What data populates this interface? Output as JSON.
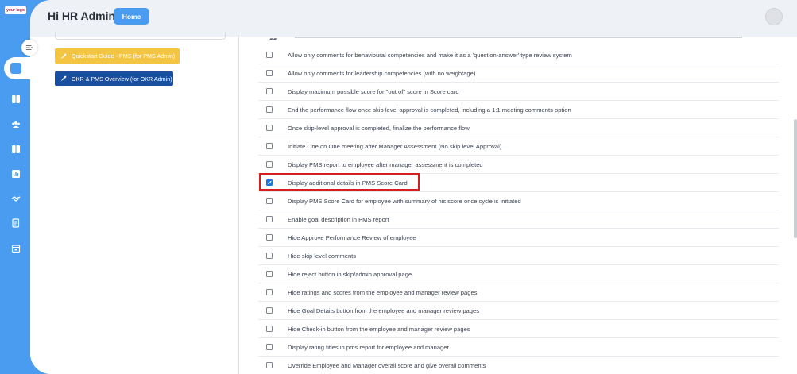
{
  "brand": {
    "logo_text": "your logo"
  },
  "header": {
    "greeting": "Hi HR Admin",
    "home_label": "Home"
  },
  "quick_links": {
    "pms_guide": "Quickstart Guide - PMS (for PMS Admin)",
    "okr_overview": "OKR & PMS Overview (for OKR Admin)"
  },
  "sidebar": {
    "icons": [
      "collapse-icon",
      "analytics-icon",
      "book-icon",
      "users-icon",
      "book-icon",
      "chart-icon",
      "handshake-icon",
      "document-icon",
      "calendar-icon"
    ]
  },
  "settings": {
    "options": [
      {
        "label": "Allow only comments for behavioural competencies and make it as a 'question-answer' type review system",
        "checked": false
      },
      {
        "label": "Allow only comments for leadership competencies (with no weightage)",
        "checked": false
      },
      {
        "label": "Display maximum possible score for \"out of\" score in Score card",
        "checked": false
      },
      {
        "label": "End the performance flow once skip level approval is completed, including a 1:1 meeting comments option",
        "checked": false
      },
      {
        "label": "Once skip-level approval is completed, finalize the performance flow",
        "checked": false
      },
      {
        "label": "Initiate One on One meeting after Manager Assessment (No skip level Approval)",
        "checked": false
      },
      {
        "label": "Display PMS report to employee after manager assessment is completed",
        "checked": false
      },
      {
        "label": "Display additional details in PMS Score Card",
        "checked": true
      },
      {
        "label": "Display PMS Score Card for employee with summary of his score once cycle is initiated",
        "checked": false
      },
      {
        "label": "Enable goal description in PMS report",
        "checked": false
      },
      {
        "label": "Hide Approve Performance Review of employee",
        "checked": false
      },
      {
        "label": "Hide skip level comments",
        "checked": false
      },
      {
        "label": "Hide reject button in skip/admin approval page",
        "checked": false
      },
      {
        "label": "Hide ratings and scores from the employee and manager review pages",
        "checked": false
      },
      {
        "label": "Hide Goal Details button from the employee and manager review pages",
        "checked": false
      },
      {
        "label": "Hide Check-in button from the employee and manager review pages",
        "checked": false
      },
      {
        "label": "Display rating titles in pms report for employee and manager",
        "checked": false
      },
      {
        "label": "Override Employee and Manager overall score and give overall comments",
        "checked": false
      }
    ]
  },
  "colors": {
    "accent": "#4a9cf0",
    "highlight": "#d71d1d",
    "yellow": "#f4c542",
    "navy": "#1a4e9f"
  }
}
